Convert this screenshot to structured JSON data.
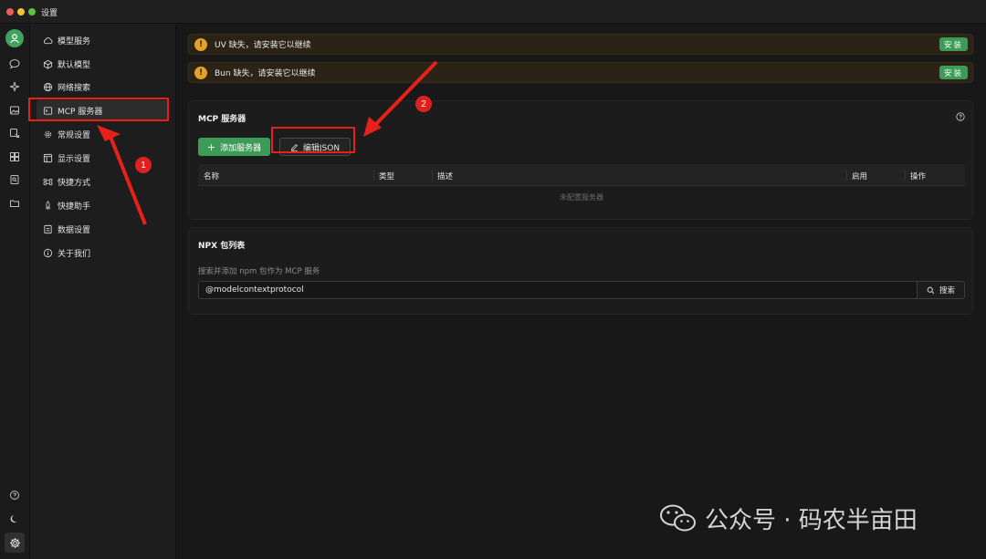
{
  "window": {
    "title": "设置"
  },
  "nav": {
    "items": [
      {
        "label": "模型服务",
        "icon": "cloud-icon"
      },
      {
        "label": "默认模型",
        "icon": "cube-icon"
      },
      {
        "label": "网络搜索",
        "icon": "globe-icon"
      },
      {
        "label": "MCP 服务器",
        "icon": "terminal-icon",
        "active": true
      },
      {
        "label": "常规设置",
        "icon": "gear-icon"
      },
      {
        "label": "显示设置",
        "icon": "layout-icon"
      },
      {
        "label": "快捷方式",
        "icon": "command-icon"
      },
      {
        "label": "快捷助手",
        "icon": "rocket-icon"
      },
      {
        "label": "数据设置",
        "icon": "database-icon"
      },
      {
        "label": "关于我们",
        "icon": "info-icon"
      }
    ]
  },
  "alerts": [
    {
      "text": "UV 缺失，请安装它以继续",
      "button": "安装"
    },
    {
      "text": "Bun 缺失，请安装它以继续",
      "button": "安装"
    }
  ],
  "mcp": {
    "title": "MCP 服务器",
    "add_button": "添加服务器",
    "edit_button": "编辑JSON",
    "columns": [
      "名称",
      "类型",
      "描述",
      "启用",
      "操作"
    ],
    "empty_text": "未配置服务器"
  },
  "npx": {
    "title": "NPX 包列表",
    "subtitle": "搜索并添加 npm 包作为 MCP 服务",
    "search_value": "@modelcontextprotocol",
    "search_button": "搜索"
  },
  "annotations": {
    "badge1": "1",
    "badge2": "2"
  },
  "watermark": {
    "text": "公众号 · 码农半亩田"
  },
  "colors": {
    "accent_green": "#3d9b58",
    "annotation_red": "#e8201a",
    "warning": "#e2a228"
  }
}
